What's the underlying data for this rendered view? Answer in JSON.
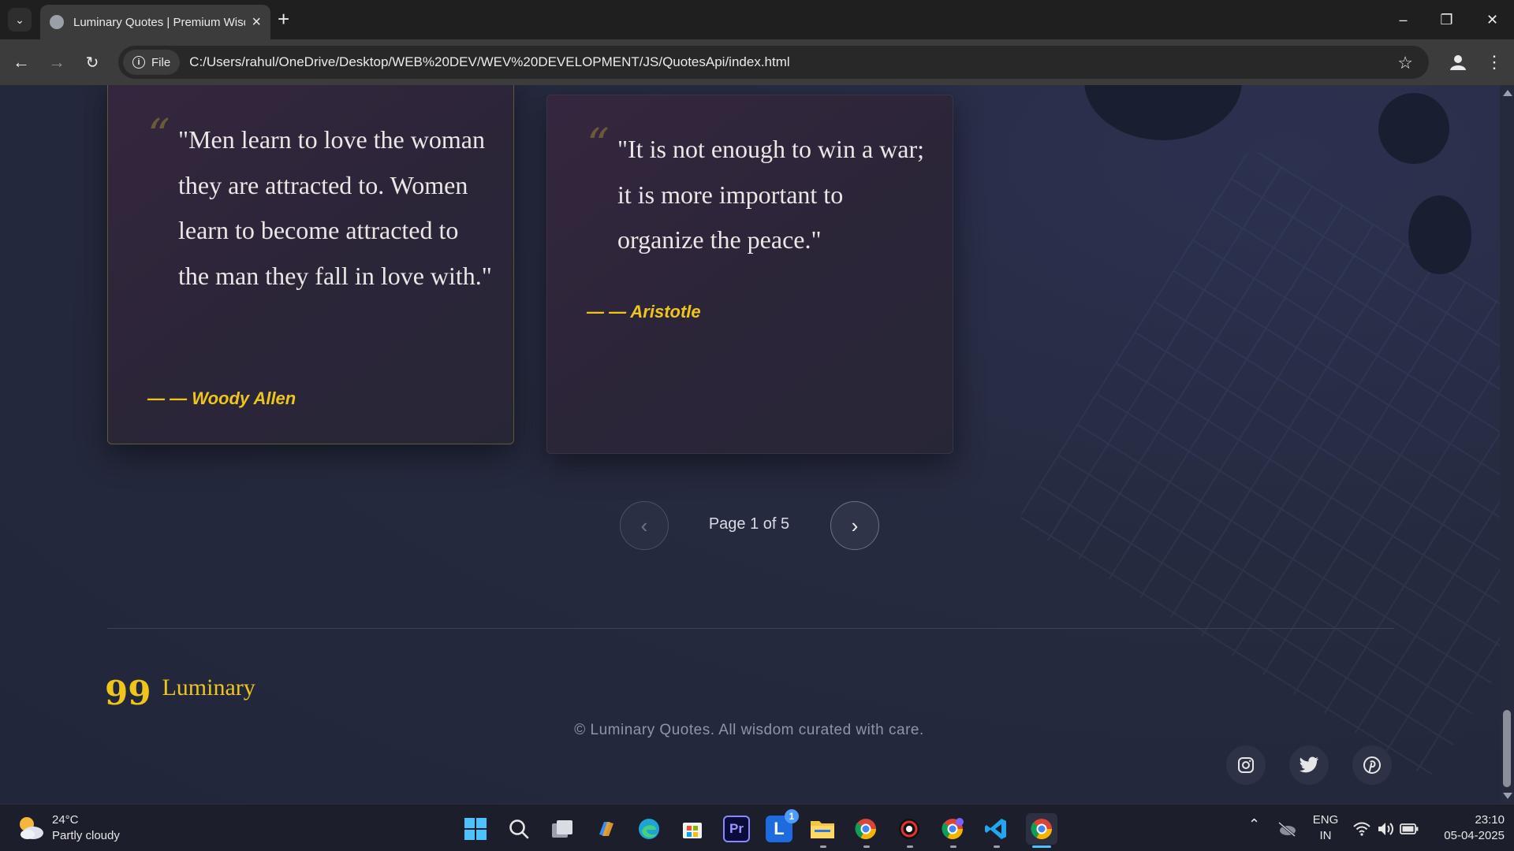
{
  "browser": {
    "tab_title": "Luminary Quotes | Premium Wisdom",
    "new_tab_symbol": "+",
    "url_chip": "File",
    "url": "C:/Users/rahul/OneDrive/Desktop/WEB%20DEV/WEV%20DEVELOPMENT/JS/QuotesApi/index.html"
  },
  "quotes": [
    {
      "text": "\"Men learn to love the woman they are attracted to. Women learn to become attracted to the man they fall in love with.\"",
      "author": "— — Woody Allen"
    },
    {
      "text": "\"It is not enough to win a war; it is more important to organize the peace.\"",
      "author": "— — Aristotle"
    }
  ],
  "pagination": {
    "label": "Page 1 of 5"
  },
  "footer": {
    "brand_icon": "99",
    "brand_name": "Luminary",
    "copyright": "© Luminary Quotes. All wisdom curated with care.",
    "social": [
      "instagram-icon",
      "twitter-icon",
      "pinterest-icon"
    ]
  },
  "taskbar": {
    "weather_temp": "24°C",
    "weather_desc": "Partly cloudy",
    "lang_top": "ENG",
    "lang_bottom": "IN",
    "time": "23:10",
    "date": "05-04-2025",
    "badge_count": "1"
  },
  "colors": {
    "accent": "#f0c51a",
    "page_bg": "#22263a"
  }
}
